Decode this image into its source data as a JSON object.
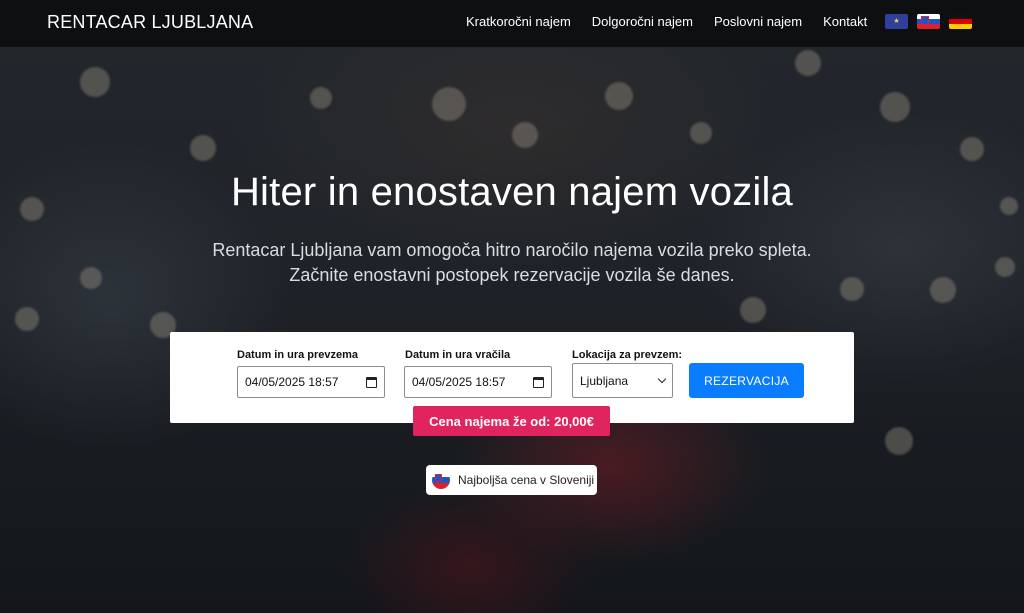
{
  "navbar": {
    "brand": "RENTACAR LJUBLJANA",
    "links": [
      "Kratkoročni najem",
      "Dolgoročni najem",
      "Poslovni najem",
      "Kontakt"
    ],
    "flags": [
      "eu-flag-icon",
      "slovenia-flag-icon",
      "germany-flag-icon"
    ]
  },
  "hero": {
    "title": "Hiter in enostaven najem vozila",
    "subtitle_line1": "Rentacar Ljubljana vam omogoča hitro naročilo najema vozila preko spleta.",
    "subtitle_line2": "Začnite enostavni postopek rezervacije vozila še danes."
  },
  "booking": {
    "pickup_label": "Datum in ura prevzema",
    "pickup_value": "04/05/2025 18:57",
    "return_label": "Datum in ura vračila",
    "return_value": "04/05/2025 18:57",
    "location_label": "Lokacija za prevzem:",
    "location_value": "Ljubljana",
    "submit_label": "REZERVACIJA"
  },
  "price_badge": "Cena najema že od: 20,00€",
  "best_price": "Najboljša cena v Sloveniji",
  "colors": {
    "accent_blue": "#0a7cff",
    "price_pink": "#e0245e",
    "navbar_bg": "#0d0f11"
  }
}
